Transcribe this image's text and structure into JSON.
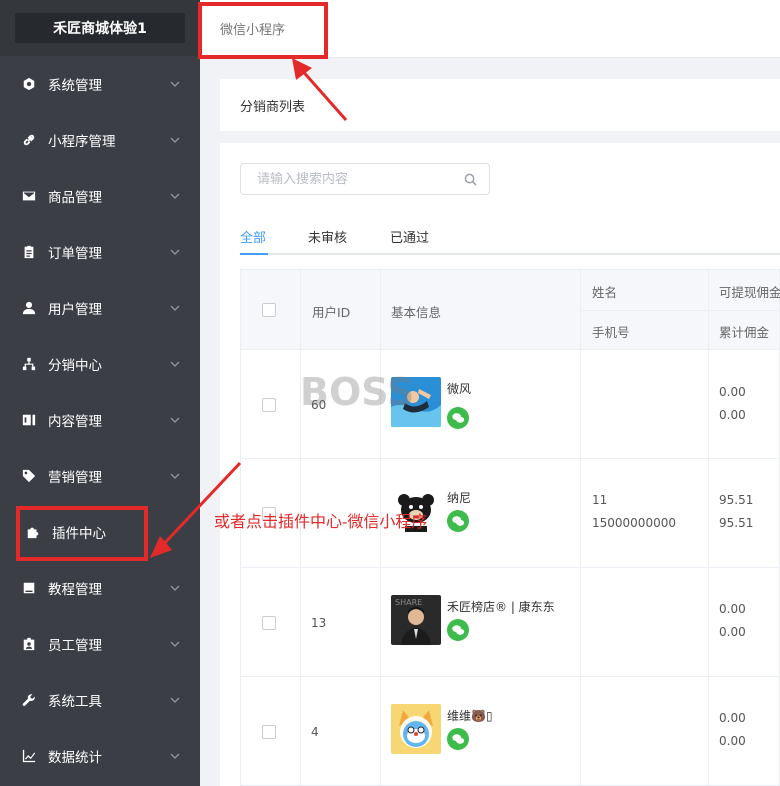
{
  "brand": "禾匠商城体验1",
  "sidebar": {
    "items": [
      {
        "label": "系统管理",
        "icon": "settings-icon"
      },
      {
        "label": "小程序管理",
        "icon": "link-icon"
      },
      {
        "label": "商品管理",
        "icon": "envelope-icon"
      },
      {
        "label": "订单管理",
        "icon": "clipboard-icon"
      },
      {
        "label": "用户管理",
        "icon": "user-icon"
      },
      {
        "label": "分销中心",
        "icon": "sitemap-icon"
      },
      {
        "label": "内容管理",
        "icon": "content-icon"
      },
      {
        "label": "营销管理",
        "icon": "tag-icon"
      },
      {
        "label": "插件中心",
        "icon": "puzzle-icon"
      },
      {
        "label": "教程管理",
        "icon": "book-icon"
      },
      {
        "label": "员工管理",
        "icon": "id-badge-icon"
      },
      {
        "label": "系统工具",
        "icon": "wrench-icon"
      },
      {
        "label": "数据统计",
        "icon": "line-chart-icon"
      }
    ]
  },
  "topbar": {
    "tab_label": "微信小程序"
  },
  "page": {
    "title": "分销商列表"
  },
  "search": {
    "placeholder": "请输入搜索内容"
  },
  "tabs": [
    {
      "label": "全部",
      "active": true
    },
    {
      "label": "未审核",
      "active": false
    },
    {
      "label": "已通过",
      "active": false
    }
  ],
  "table": {
    "headers": {
      "user_id": "用户ID",
      "basic_info": "基本信息",
      "name": "姓名",
      "phone": "手机号",
      "withdrawable": "可提现佣金",
      "total": "累计佣金"
    },
    "rows": [
      {
        "user_id": "60",
        "nickname": "微风",
        "name": "",
        "phone": "",
        "withdrawable": "0.00",
        "total": "0.00",
        "avatar": "swimmer"
      },
      {
        "user_id": "",
        "nickname": "纳尼",
        "name": "11",
        "phone": "15000000000",
        "withdrawable": "95.51",
        "total": "95.51",
        "avatar": "bear"
      },
      {
        "user_id": "13",
        "nickname": "禾匠榜店® | 康东东",
        "name": "",
        "phone": "",
        "withdrawable": "0.00",
        "total": "0.00",
        "avatar": "man"
      },
      {
        "user_id": "4",
        "nickname": "维维🐻▯",
        "name": "",
        "phone": "",
        "withdrawable": "0.00",
        "total": "0.00",
        "avatar": "cat"
      }
    ]
  },
  "annotation": {
    "text": "或者点击插件中心-微信小程序",
    "color": "#e3292a"
  },
  "watermark": "BOSS"
}
